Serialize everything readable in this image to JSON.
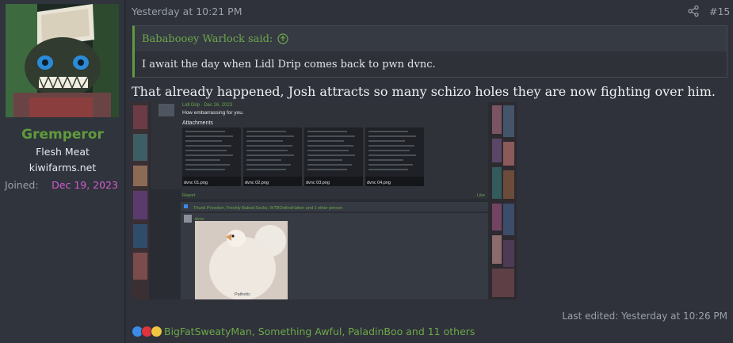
{
  "user": {
    "name": "Gremperor",
    "title": "Flesh Meat",
    "banner": "kiwifarms.net",
    "joined_label": "Joined:",
    "joined_value": "Dec 19, 2023"
  },
  "post": {
    "date": "Yesterday at 10:21 PM",
    "number": "#15",
    "quote_author": "Bababooey Warlock said:",
    "quote_text": "I await the day when Lidl Drip comes back to pwn dvnc.",
    "body": "That already happened, Josh attracts so many schizo holes they are now fighting over him.",
    "edited": "Last edited: Yesterday at 10:26 PM",
    "reactions_text": "BigFatSweatyMan, Something Awful, PaladinBoo and 11 others"
  },
  "embed": {
    "author": "Lidl Drip · Dec 26, 2023",
    "message": "How embarrassing for you.",
    "attachments_label": "Attachments",
    "files": [
      "dvnc 01.png",
      "dvnc 02.png",
      "dvnc 03.png",
      "dvnc 04.png"
    ],
    "report": "Report",
    "like": "Like",
    "reacted": "Thunk Provoker, Freshly Baked Socks, WTBOnlineFather and 1 other person",
    "reply_author": "dvnc",
    "image_caption": "Pathetic"
  },
  "icons": [
    "share-icon",
    "arrow-up-circle-icon",
    "like-icon",
    "heart-icon",
    "moon-icon"
  ],
  "colors": {
    "accent_green": "#5f9b3c",
    "joined_pink": "#d45cd0",
    "like_blue": "#3b8beb",
    "heart_red": "#e0343c"
  }
}
